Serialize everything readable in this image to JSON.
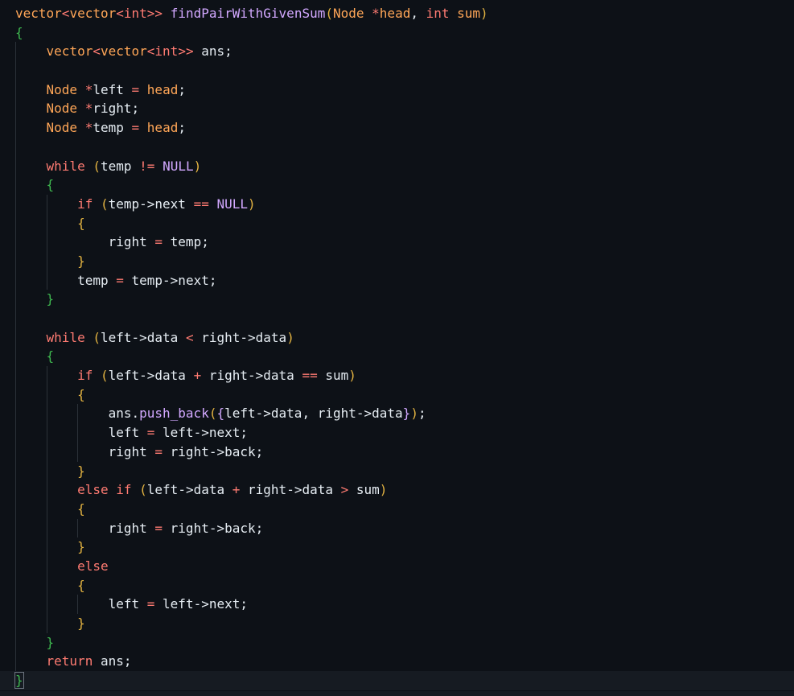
{
  "colors": {
    "background": "#0d1117",
    "plain": "#e6edf3",
    "type": "#ffa657",
    "keyword": "#ff7b72",
    "function": "#d2a8ff",
    "constant": "#d2a8ff",
    "brace_level1": "#3fb950",
    "brace_level2": "#e3b341"
  },
  "lines": [
    {
      "tokens": [
        {
          "t": "vector",
          "c": "type"
        },
        {
          "t": "<",
          "c": "keyword"
        },
        {
          "t": "vector",
          "c": "type"
        },
        {
          "t": "<",
          "c": "keyword"
        },
        {
          "t": "int",
          "c": "keyword"
        },
        {
          "t": ">>",
          "c": "keyword"
        },
        {
          "t": " ",
          "c": "plain"
        },
        {
          "t": "findPairWithGivenSum",
          "c": "function"
        },
        {
          "t": "(",
          "c": "brace_level2"
        },
        {
          "t": "Node",
          "c": "type"
        },
        {
          "t": " ",
          "c": "plain"
        },
        {
          "t": "*",
          "c": "keyword"
        },
        {
          "t": "head",
          "c": "type"
        },
        {
          "t": ", ",
          "c": "plain"
        },
        {
          "t": "int",
          "c": "keyword"
        },
        {
          "t": " ",
          "c": "plain"
        },
        {
          "t": "sum",
          "c": "type"
        },
        {
          "t": ")",
          "c": "brace_level2"
        }
      ]
    },
    {
      "tokens": [
        {
          "t": "{",
          "c": "brace_level1"
        }
      ]
    },
    {
      "tokens": [
        {
          "t": "    ",
          "c": "plain"
        },
        {
          "t": "vector",
          "c": "type"
        },
        {
          "t": "<",
          "c": "keyword"
        },
        {
          "t": "vector",
          "c": "type"
        },
        {
          "t": "<",
          "c": "keyword"
        },
        {
          "t": "int",
          "c": "keyword"
        },
        {
          "t": ">>",
          "c": "keyword"
        },
        {
          "t": " ans;",
          "c": "plain"
        }
      ]
    },
    {
      "tokens": []
    },
    {
      "tokens": [
        {
          "t": "    ",
          "c": "plain"
        },
        {
          "t": "Node",
          "c": "type"
        },
        {
          "t": " ",
          "c": "plain"
        },
        {
          "t": "*",
          "c": "keyword"
        },
        {
          "t": "left ",
          "c": "plain"
        },
        {
          "t": "=",
          "c": "keyword"
        },
        {
          "t": " ",
          "c": "plain"
        },
        {
          "t": "head",
          "c": "type"
        },
        {
          "t": ";",
          "c": "plain"
        }
      ]
    },
    {
      "tokens": [
        {
          "t": "    ",
          "c": "plain"
        },
        {
          "t": "Node",
          "c": "type"
        },
        {
          "t": " ",
          "c": "plain"
        },
        {
          "t": "*",
          "c": "keyword"
        },
        {
          "t": "right;",
          "c": "plain"
        }
      ]
    },
    {
      "tokens": [
        {
          "t": "    ",
          "c": "plain"
        },
        {
          "t": "Node",
          "c": "type"
        },
        {
          "t": " ",
          "c": "plain"
        },
        {
          "t": "*",
          "c": "keyword"
        },
        {
          "t": "temp ",
          "c": "plain"
        },
        {
          "t": "=",
          "c": "keyword"
        },
        {
          "t": " ",
          "c": "plain"
        },
        {
          "t": "head",
          "c": "type"
        },
        {
          "t": ";",
          "c": "plain"
        }
      ]
    },
    {
      "tokens": []
    },
    {
      "tokens": [
        {
          "t": "    ",
          "c": "plain"
        },
        {
          "t": "while",
          "c": "keyword"
        },
        {
          "t": " ",
          "c": "plain"
        },
        {
          "t": "(",
          "c": "brace_level2"
        },
        {
          "t": "temp ",
          "c": "plain"
        },
        {
          "t": "!=",
          "c": "keyword"
        },
        {
          "t": " ",
          "c": "plain"
        },
        {
          "t": "NULL",
          "c": "constant"
        },
        {
          "t": ")",
          "c": "brace_level2"
        }
      ]
    },
    {
      "tokens": [
        {
          "t": "    ",
          "c": "plain"
        },
        {
          "t": "{",
          "c": "brace_level1"
        }
      ]
    },
    {
      "tokens": [
        {
          "t": "        ",
          "c": "plain"
        },
        {
          "t": "if",
          "c": "keyword"
        },
        {
          "t": " ",
          "c": "plain"
        },
        {
          "t": "(",
          "c": "brace_level2"
        },
        {
          "t": "temp->next ",
          "c": "plain"
        },
        {
          "t": "==",
          "c": "keyword"
        },
        {
          "t": " ",
          "c": "plain"
        },
        {
          "t": "NULL",
          "c": "constant"
        },
        {
          "t": ")",
          "c": "brace_level2"
        }
      ]
    },
    {
      "tokens": [
        {
          "t": "        ",
          "c": "plain"
        },
        {
          "t": "{",
          "c": "brace_level2"
        }
      ]
    },
    {
      "tokens": [
        {
          "t": "            right ",
          "c": "plain"
        },
        {
          "t": "=",
          "c": "keyword"
        },
        {
          "t": " temp;",
          "c": "plain"
        }
      ]
    },
    {
      "tokens": [
        {
          "t": "        ",
          "c": "plain"
        },
        {
          "t": "}",
          "c": "brace_level2"
        }
      ]
    },
    {
      "tokens": [
        {
          "t": "        temp ",
          "c": "plain"
        },
        {
          "t": "=",
          "c": "keyword"
        },
        {
          "t": " temp->next;",
          "c": "plain"
        }
      ]
    },
    {
      "tokens": [
        {
          "t": "    ",
          "c": "plain"
        },
        {
          "t": "}",
          "c": "brace_level1"
        }
      ]
    },
    {
      "tokens": []
    },
    {
      "tokens": [
        {
          "t": "    ",
          "c": "plain"
        },
        {
          "t": "while",
          "c": "keyword"
        },
        {
          "t": " ",
          "c": "plain"
        },
        {
          "t": "(",
          "c": "brace_level2"
        },
        {
          "t": "left->data ",
          "c": "plain"
        },
        {
          "t": "<",
          "c": "keyword"
        },
        {
          "t": " right->data",
          "c": "plain"
        },
        {
          "t": ")",
          "c": "brace_level2"
        }
      ]
    },
    {
      "tokens": [
        {
          "t": "    ",
          "c": "plain"
        },
        {
          "t": "{",
          "c": "brace_level1"
        }
      ]
    },
    {
      "tokens": [
        {
          "t": "        ",
          "c": "plain"
        },
        {
          "t": "if",
          "c": "keyword"
        },
        {
          "t": " ",
          "c": "plain"
        },
        {
          "t": "(",
          "c": "brace_level2"
        },
        {
          "t": "left->data ",
          "c": "plain"
        },
        {
          "t": "+",
          "c": "keyword"
        },
        {
          "t": " right->data ",
          "c": "plain"
        },
        {
          "t": "==",
          "c": "keyword"
        },
        {
          "t": " sum",
          "c": "plain"
        },
        {
          "t": ")",
          "c": "brace_level2"
        }
      ]
    },
    {
      "tokens": [
        {
          "t": "        ",
          "c": "plain"
        },
        {
          "t": "{",
          "c": "brace_level2"
        }
      ]
    },
    {
      "tokens": [
        {
          "t": "            ans.",
          "c": "plain"
        },
        {
          "t": "push_back",
          "c": "function"
        },
        {
          "t": "(",
          "c": "brace_level2"
        },
        {
          "t": "{",
          "c": "function"
        },
        {
          "t": "left->data, right->data",
          "c": "plain"
        },
        {
          "t": "}",
          "c": "function"
        },
        {
          "t": ")",
          "c": "brace_level2"
        },
        {
          "t": ";",
          "c": "plain"
        }
      ]
    },
    {
      "tokens": [
        {
          "t": "            left ",
          "c": "plain"
        },
        {
          "t": "=",
          "c": "keyword"
        },
        {
          "t": " left->next;",
          "c": "plain"
        }
      ]
    },
    {
      "tokens": [
        {
          "t": "            right ",
          "c": "plain"
        },
        {
          "t": "=",
          "c": "keyword"
        },
        {
          "t": " right->back;",
          "c": "plain"
        }
      ]
    },
    {
      "tokens": [
        {
          "t": "        ",
          "c": "plain"
        },
        {
          "t": "}",
          "c": "brace_level2"
        }
      ]
    },
    {
      "tokens": [
        {
          "t": "        ",
          "c": "plain"
        },
        {
          "t": "else",
          "c": "keyword"
        },
        {
          "t": " ",
          "c": "plain"
        },
        {
          "t": "if",
          "c": "keyword"
        },
        {
          "t": " ",
          "c": "plain"
        },
        {
          "t": "(",
          "c": "brace_level2"
        },
        {
          "t": "left->data ",
          "c": "plain"
        },
        {
          "t": "+",
          "c": "keyword"
        },
        {
          "t": " right->data ",
          "c": "plain"
        },
        {
          "t": ">",
          "c": "keyword"
        },
        {
          "t": " sum",
          "c": "plain"
        },
        {
          "t": ")",
          "c": "brace_level2"
        }
      ]
    },
    {
      "tokens": [
        {
          "t": "        ",
          "c": "plain"
        },
        {
          "t": "{",
          "c": "brace_level2"
        }
      ]
    },
    {
      "tokens": [
        {
          "t": "            right ",
          "c": "plain"
        },
        {
          "t": "=",
          "c": "keyword"
        },
        {
          "t": " right->back;",
          "c": "plain"
        }
      ]
    },
    {
      "tokens": [
        {
          "t": "        ",
          "c": "plain"
        },
        {
          "t": "}",
          "c": "brace_level2"
        }
      ]
    },
    {
      "tokens": [
        {
          "t": "        ",
          "c": "plain"
        },
        {
          "t": "else",
          "c": "keyword"
        }
      ]
    },
    {
      "tokens": [
        {
          "t": "        ",
          "c": "plain"
        },
        {
          "t": "{",
          "c": "brace_level2"
        }
      ]
    },
    {
      "tokens": [
        {
          "t": "            left ",
          "c": "plain"
        },
        {
          "t": "=",
          "c": "keyword"
        },
        {
          "t": " left->next;",
          "c": "plain"
        }
      ]
    },
    {
      "tokens": [
        {
          "t": "        ",
          "c": "plain"
        },
        {
          "t": "}",
          "c": "brace_level2"
        }
      ]
    },
    {
      "tokens": [
        {
          "t": "    ",
          "c": "plain"
        },
        {
          "t": "}",
          "c": "brace_level1"
        }
      ]
    },
    {
      "tokens": [
        {
          "t": "    ",
          "c": "plain"
        },
        {
          "t": "return",
          "c": "keyword"
        },
        {
          "t": " ans;",
          "c": "plain"
        }
      ]
    },
    {
      "tokens": [
        {
          "t": "}",
          "c": "brace_level1"
        }
      ]
    }
  ]
}
